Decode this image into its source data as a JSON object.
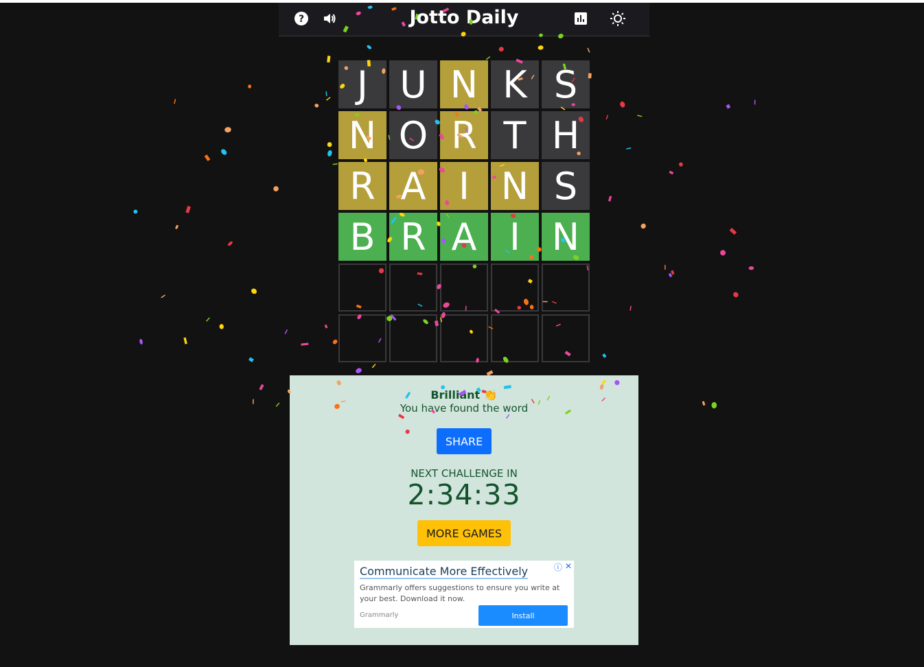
{
  "header": {
    "title": "Jotto Daily",
    "icons": [
      "help-icon",
      "volume-icon",
      "stats-icon",
      "theme-sun-icon"
    ]
  },
  "board": {
    "rows": [
      [
        {
          "l": "J",
          "s": "gray"
        },
        {
          "l": "U",
          "s": "gray"
        },
        {
          "l": "N",
          "s": "yellow"
        },
        {
          "l": "K",
          "s": "gray"
        },
        {
          "l": "S",
          "s": "gray"
        }
      ],
      [
        {
          "l": "N",
          "s": "yellow"
        },
        {
          "l": "O",
          "s": "gray"
        },
        {
          "l": "R",
          "s": "yellow"
        },
        {
          "l": "T",
          "s": "gray"
        },
        {
          "l": "H",
          "s": "gray"
        }
      ],
      [
        {
          "l": "R",
          "s": "yellow"
        },
        {
          "l": "A",
          "s": "yellow"
        },
        {
          "l": "I",
          "s": "yellow"
        },
        {
          "l": "N",
          "s": "yellow"
        },
        {
          "l": "S",
          "s": "gray"
        }
      ],
      [
        {
          "l": "B",
          "s": "green"
        },
        {
          "l": "R",
          "s": "green"
        },
        {
          "l": "A",
          "s": "green"
        },
        {
          "l": "I",
          "s": "green"
        },
        {
          "l": "N",
          "s": "green"
        }
      ],
      [
        {
          "l": "",
          "s": "empty"
        },
        {
          "l": "",
          "s": "empty"
        },
        {
          "l": "",
          "s": "empty"
        },
        {
          "l": "",
          "s": "empty"
        },
        {
          "l": "",
          "s": "empty"
        }
      ],
      [
        {
          "l": "",
          "s": "empty"
        },
        {
          "l": "",
          "s": "empty"
        },
        {
          "l": "",
          "s": "empty"
        },
        {
          "l": "",
          "s": "empty"
        },
        {
          "l": "",
          "s": "empty"
        }
      ]
    ]
  },
  "result": {
    "headline": "Brilliant 👏",
    "message": "You have found the word",
    "share_label": "SHARE",
    "next_label": "NEXT CHALLENGE IN",
    "timer": "2:34:33",
    "more_games_label": "MORE GAMES"
  },
  "ad": {
    "title": "Communicate More Effectively",
    "text": "Grammarly offers suggestions to ensure you write at your best. Download it now.",
    "brand": "Grammarly",
    "install_label": "Install"
  },
  "colors": {
    "background": "#121212",
    "tile_gray": "#3a3a3c",
    "tile_yellow": "#b59f3b",
    "tile_green": "#4caf50",
    "panel": "#d2e5dc",
    "share": "#0d6efd",
    "more_games": "#ffc107",
    "confetti": [
      "#e63946",
      "#f4a261",
      "#ffd60a",
      "#7bd321",
      "#22c3ee",
      "#a855f7",
      "#ec4899",
      "#f97316"
    ]
  }
}
